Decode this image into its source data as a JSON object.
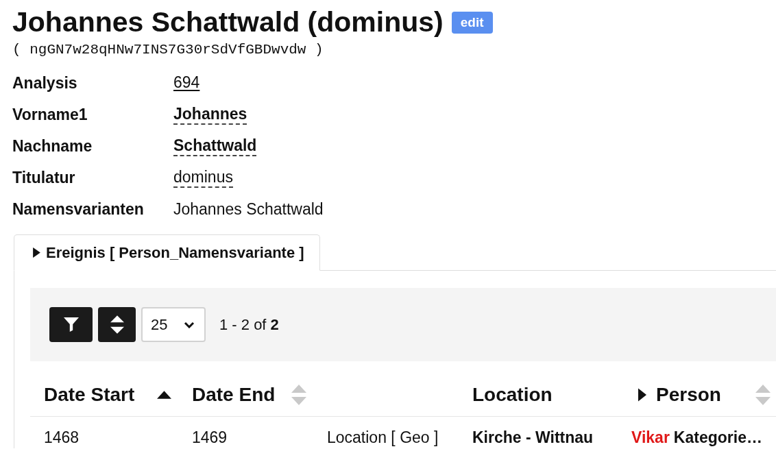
{
  "header": {
    "title": "Johannes Schattwald (dominus)",
    "edit_button": "edit",
    "identifier": "( ngGN7w28qHNw7INS7G30rSdVfGBDwvdw )"
  },
  "fields": [
    {
      "label": "Analysis",
      "value": "694",
      "kind": "link",
      "strong": false
    },
    {
      "label": "Vorname1",
      "value": "Johannes",
      "kind": "editable",
      "strong": true
    },
    {
      "label": "Nachname",
      "value": "Schattwald",
      "kind": "editable",
      "strong": true
    },
    {
      "label": "Titulatur",
      "value": "dominus",
      "kind": "editable",
      "strong": false
    },
    {
      "label": "Namensvarianten",
      "value": "Johannes Schattwald",
      "kind": "plain",
      "strong": false
    }
  ],
  "tabs": [
    {
      "label": "Ereignis [ Person_Namensvariante ]",
      "selected": true,
      "expanded": false
    }
  ],
  "toolbar": {
    "page_size": "25",
    "range": "1 - 2 of **2**"
  },
  "table": {
    "columns": [
      {
        "label": "Date Start",
        "kind": "sortable",
        "sorted": true,
        "descending": false
      },
      {
        "label": "Date End",
        "kind": "sortable",
        "sorted": false
      },
      {
        "kind": "blank"
      },
      {
        "label": "Location",
        "kind": "plain"
      },
      {
        "label": "Person",
        "kind": "sortable",
        "sorted": false,
        "expanded": false
      }
    ],
    "rows": [
      {
        "date_start": "1468",
        "date_end": "1469",
        "column_3": "Location [ Geo ]",
        "location": "Kirche - Wittnau",
        "person": {
          "role": "Vikar",
          "detail": "Kategorie…"
        }
      }
    ]
  }
}
